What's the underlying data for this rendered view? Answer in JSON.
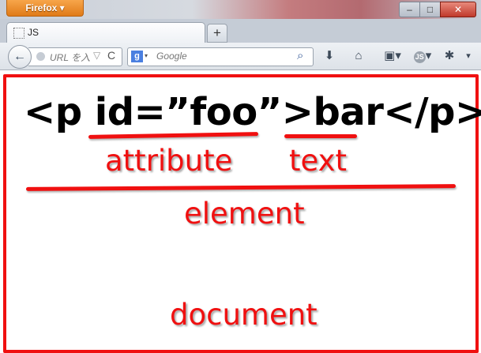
{
  "window": {
    "app_button_label": "Firefox ▾",
    "controls": {
      "minimize": "–",
      "maximize": "□",
      "close": "✕"
    }
  },
  "tabs": [
    {
      "title": "JS"
    }
  ],
  "new_tab_label": "+",
  "navbar": {
    "back_label": "←",
    "url_placeholder": "URL を入",
    "star_label": "▽",
    "reload_label": "C",
    "search_engine_badge": "g",
    "search_engine_dropdown": "▾",
    "search_placeholder": "Google",
    "search_go": "⌕",
    "toolbar_icons": {
      "download": "⬇",
      "home": "⌂",
      "bookmarks": "▣▾",
      "js_badge": "JS",
      "js_dropdown": "▾",
      "extension": "✱",
      "menu": "▾"
    }
  },
  "page": {
    "code_text": "<p id=”foo”>bar</p>",
    "annotations": {
      "attribute": "attribute",
      "text": "text",
      "element": "element",
      "document": "document"
    },
    "annotation_color": "#f01010"
  }
}
